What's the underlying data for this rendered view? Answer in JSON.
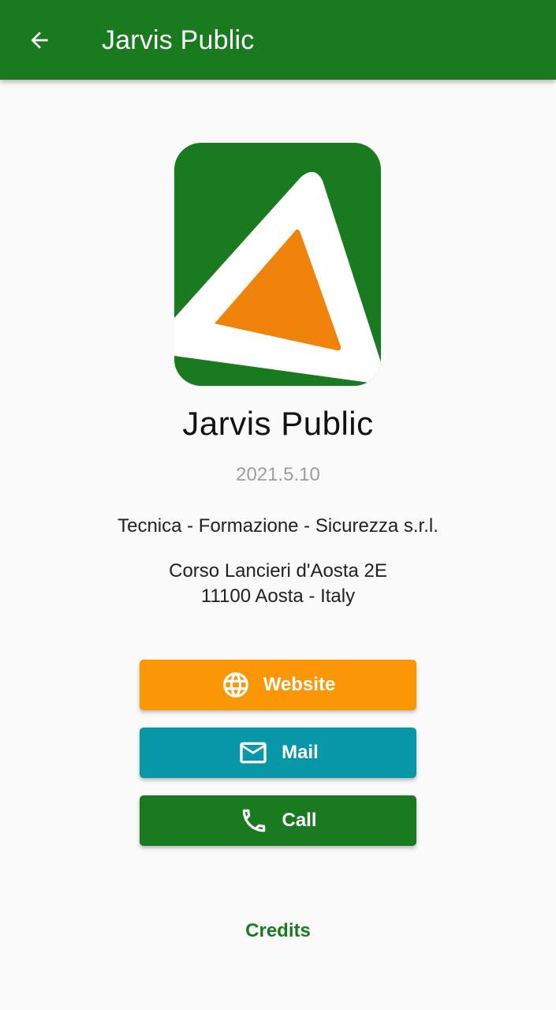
{
  "appbar": {
    "title": "Jarvis Public",
    "back_icon": "arrow-left-icon"
  },
  "about": {
    "logo_icon": "jarvis-logo",
    "app_name": "Jarvis Public",
    "version": "2021.5.10",
    "company": "Tecnica - Formazione - Sicurezza s.r.l.",
    "address_line1": "Corso Lancieri d'Aosta 2E",
    "address_line2": "11100 Aosta - Italy"
  },
  "buttons": {
    "website": {
      "label": "Website",
      "icon": "globe-icon",
      "color": "#fb9704"
    },
    "mail": {
      "label": "Mail",
      "icon": "mail-icon",
      "color": "#0797a8"
    },
    "call": {
      "label": "Call",
      "icon": "phone-icon",
      "color": "#1a7a1f"
    }
  },
  "credits": {
    "label": "Credits",
    "color": "#1a7a1f"
  },
  "colors": {
    "primary": "#1a7a1f",
    "accent": "#f0830a",
    "background": "#fafafa"
  }
}
